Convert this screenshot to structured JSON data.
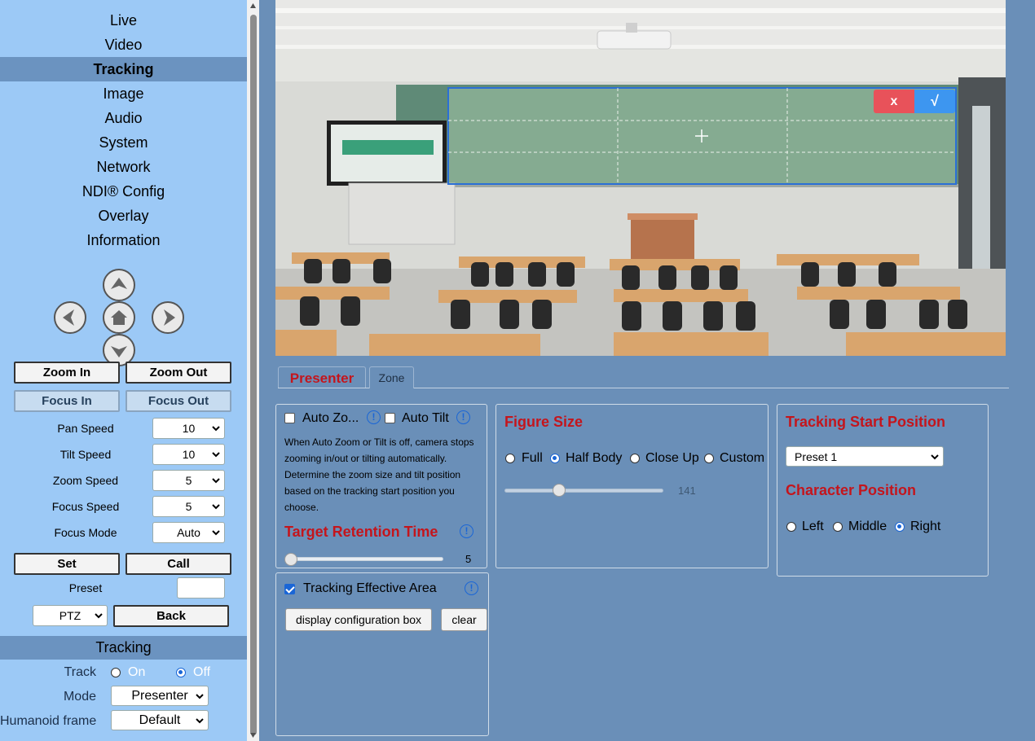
{
  "nav": {
    "items": [
      {
        "label": "Live"
      },
      {
        "label": "Video"
      },
      {
        "label": "Tracking"
      },
      {
        "label": "Image"
      },
      {
        "label": "Audio"
      },
      {
        "label": "System"
      },
      {
        "label": "Network"
      },
      {
        "label": "NDI® Config"
      },
      {
        "label": "Overlay"
      },
      {
        "label": "Information"
      }
    ],
    "active": "Tracking"
  },
  "ptz": {
    "zoom_in": "Zoom In",
    "zoom_out": "Zoom Out",
    "focus_in": "Focus In",
    "focus_out": "Focus Out",
    "pan_speed_label": "Pan Speed",
    "pan_speed": "10",
    "tilt_speed_label": "Tilt Speed",
    "tilt_speed": "10",
    "zoom_speed_label": "Zoom Speed",
    "zoom_speed": "5",
    "focus_speed_label": "Focus Speed",
    "focus_speed": "5",
    "focus_mode_label": "Focus Mode",
    "focus_mode": "Auto",
    "set": "Set",
    "call": "Call",
    "preset_label": "Preset",
    "preset_value": "",
    "ptz_select": "PTZ",
    "back": "Back"
  },
  "tracking_section": {
    "header": "Tracking",
    "track_label": "Track",
    "track_on": "On",
    "track_off": "Off",
    "track_value": "Off",
    "mode_label": "Mode",
    "mode_value": "Presenter",
    "humanoid_label": "Humanoid frame",
    "humanoid_value": "Default"
  },
  "video": {
    "overlay_close": "x",
    "overlay_confirm": "√"
  },
  "tabs": [
    {
      "label": "Presenter",
      "active": true
    },
    {
      "label": "Zone",
      "active": false
    }
  ],
  "auto_panel": {
    "auto_zoom_label": "Auto Zo...",
    "auto_zoom_checked": false,
    "auto_tilt_label": "Auto Tilt",
    "auto_tilt_checked": false,
    "description": "When Auto Zoom or Tilt is off, camera stops zooming in/out or tilting automatically. Determine the zoom size and tilt position based on the tracking start position you choose.",
    "retention_title": "Target Retention Time",
    "retention_value": "5",
    "retention_fraction": 0.0
  },
  "effective_area": {
    "label": "Tracking Effective Area",
    "checked": true,
    "display_btn": "display configuration box",
    "clear_btn": "clear"
  },
  "figure_size": {
    "title": "Figure Size",
    "options": [
      "Full",
      "Half Body",
      "Close Up",
      "Custom"
    ],
    "selected": "Half Body",
    "slider_value": "141",
    "slider_fraction": 0.3
  },
  "start_position": {
    "title": "Tracking Start Position",
    "selected": "Preset 1",
    "char_title": "Character Position",
    "char_options": [
      "Left",
      "Middle",
      "Right"
    ],
    "char_selected": "Right"
  },
  "colors": {
    "accent_red": "#c4151c",
    "radio_blue": "#1a66d6",
    "sidebar_bg": "#9cc9f6",
    "main_bg": "#6a8fb8"
  }
}
